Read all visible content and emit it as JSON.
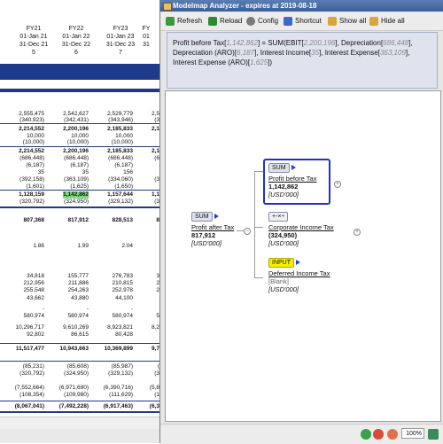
{
  "sheet": {
    "headers": [
      {
        "fy": "FY21",
        "date1": "01-Jan 21",
        "date2": "31-Dec 21",
        "idx": "5"
      },
      {
        "fy": "FY22",
        "date1": "01-Jan 22",
        "date2": "31-Dec 22",
        "idx": "6"
      },
      {
        "fy": "FY23",
        "date1": "01-Jan 23",
        "date2": "31-Dec 23",
        "idx": "7"
      },
      {
        "fy": "FY",
        "date1": "01",
        "date2": "31",
        "idx": ""
      }
    ],
    "rows": [
      [
        "2,555,475",
        "2,542,627",
        "2,529,779",
        "2,5"
      ],
      [
        "(340,923)",
        "(342,431)",
        "(343,946)",
        "(3"
      ],
      [
        "2,214,552",
        "2,200,196",
        "2,185,833",
        "2,1"
      ],
      [
        "10,000",
        "10,000",
        "10,000",
        ""
      ],
      [
        "(10,000)",
        "(10,000)",
        "(10,000)",
        ""
      ],
      [
        "2,214,552",
        "2,200,196",
        "2,185,833",
        "2,1"
      ],
      [
        "(686,448)",
        "(686,448)",
        "(686,448)",
        "(6"
      ],
      [
        "(6,187)",
        "(6,187)",
        "(6,187)",
        ""
      ],
      [
        "35",
        "35",
        "156",
        ""
      ],
      [
        "(392,158)",
        "(363,109)",
        "(334,060)",
        "(3"
      ],
      [
        "(1,601)",
        "(1,625)",
        "(1,650)",
        ""
      ],
      [
        "1,128,159",
        "1,142,862",
        "1,157,644",
        "1,1"
      ],
      [
        "(320,792)",
        "(324,950)",
        "(329,132)",
        "(3"
      ],
      [
        "807,368",
        "817,912",
        "828,513",
        "8"
      ],
      [
        "1.86",
        "1.99",
        "2.04",
        ""
      ],
      [
        "34,818",
        "155,777",
        "276,783",
        "3"
      ],
      [
        "212,956",
        "211,886",
        "210,815",
        "2"
      ],
      [
        "255,548",
        "254,263",
        "252,978",
        "2"
      ],
      [
        "43,662",
        "43,880",
        "44,100",
        ""
      ],
      [
        "-",
        "-",
        "-",
        ""
      ],
      [
        "580,974",
        "580,974",
        "580,974",
        "5"
      ],
      [
        "10,296,717",
        "9,610,269",
        "8,923,821",
        "8,2"
      ],
      [
        "92,802",
        "86,615",
        "80,428",
        ""
      ],
      [
        "11,517,477",
        "10,943,663",
        "10,369,899",
        "9,7"
      ],
      [
        "(85,231)",
        "(85,608)",
        "(85,987)",
        "("
      ],
      [
        "(320,792)",
        "(324,950)",
        "(329,132)",
        "(3"
      ],
      [
        "(7,552,664)",
        "(6,971,690)",
        "(6,390,716)",
        "(5,8"
      ],
      [
        "(108,354)",
        "(109,980)",
        "(111,629)",
        "(1"
      ],
      [
        "(8,067,041)",
        "(7,492,228)",
        "(6,917,463)",
        "(6,3"
      ]
    ],
    "left_edge": [
      "4",
      "",
      ")",
      "",
      "",
      "",
      ")",
      ")",
      "",
      ")",
      ")",
      "0",
      ")",
      ""
    ]
  },
  "window": {
    "title": "Modelmap Analyzer - expires at 2019-08-18",
    "toolbar": {
      "refresh": "Refresh",
      "reload": "Reload",
      "config": "Config",
      "shortcut": "Shortcut",
      "show_all": "Show all",
      "hide_all": "Hide all"
    },
    "formula": {
      "lhs": "Profit before Tax",
      "lhs_val": "1,142,862",
      "eq": "= SUM(",
      "t1": "EBIT",
      "t1_val": "2,200,196",
      "t2": "Depreciation",
      "t2_val": "686,448",
      "t3": "Depreciation (ARO)",
      "t3_val": "6,187",
      "t4": "Interest Income",
      "t4_val": "35",
      "t5": "Interest Expense",
      "t5_val": "363,109",
      "t6": "Interest Expense (ARO)",
      "t6_val": "1,625",
      "close": "])"
    },
    "nodes": {
      "root": {
        "badge": "SUM",
        "name": "Profit after Tax",
        "value": "817,912",
        "unit": "[USD'000]"
      },
      "child1": {
        "badge": "SUM",
        "name": "Profit before Tax",
        "value": "1,142,862",
        "unit": "[USD'000]"
      },
      "child2": {
        "badge": "+-×÷",
        "name": "Corporate Income Tax",
        "value": "(324,950)",
        "unit": "[USD'000]"
      },
      "child3": {
        "badge": "INPUT",
        "name": "Deferred Income Tax",
        "value": "[Blank]",
        "unit": "[USD'000]"
      }
    },
    "zoom": "100%"
  }
}
